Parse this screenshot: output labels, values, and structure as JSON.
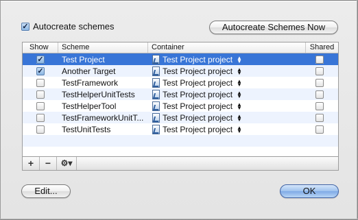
{
  "autocreate": {
    "label": "Autocreate schemes",
    "checked": true
  },
  "buttons": {
    "autocreate_now": "Autocreate Schemes Now",
    "edit": "Edit...",
    "ok": "OK"
  },
  "table": {
    "headers": {
      "show": "Show",
      "scheme": "Scheme",
      "container": "Container",
      "shared": "Shared"
    },
    "rows": [
      {
        "show": true,
        "scheme": "Test Project",
        "container": "Test Project project",
        "shared": false,
        "selected": true
      },
      {
        "show": true,
        "scheme": "Another Target",
        "container": "Test Project project",
        "shared": false
      },
      {
        "show": false,
        "scheme": "TestFramework",
        "container": "Test Project project",
        "shared": false
      },
      {
        "show": false,
        "scheme": "TestHelperUnitTests",
        "container": "Test Project project",
        "shared": false
      },
      {
        "show": false,
        "scheme": "TestHelperTool",
        "container": "Test Project project",
        "shared": false
      },
      {
        "show": false,
        "scheme": "TestFrameworkUnitT...",
        "container": "Test Project project",
        "shared": false
      },
      {
        "show": false,
        "scheme": "TestUnitTests",
        "container": "Test Project project",
        "shared": false
      }
    ]
  },
  "toolbar": {
    "add": "+",
    "remove": "−",
    "action": "⚙▾"
  },
  "icons": {
    "project": "xcode-project-icon",
    "popup": "popup-arrows-icon",
    "check": "checkmark-icon",
    "gear": "gear-icon"
  },
  "colors": {
    "selection": "#3875d7",
    "alt_row": "#edf3fe",
    "default_button": "#7faae5"
  }
}
